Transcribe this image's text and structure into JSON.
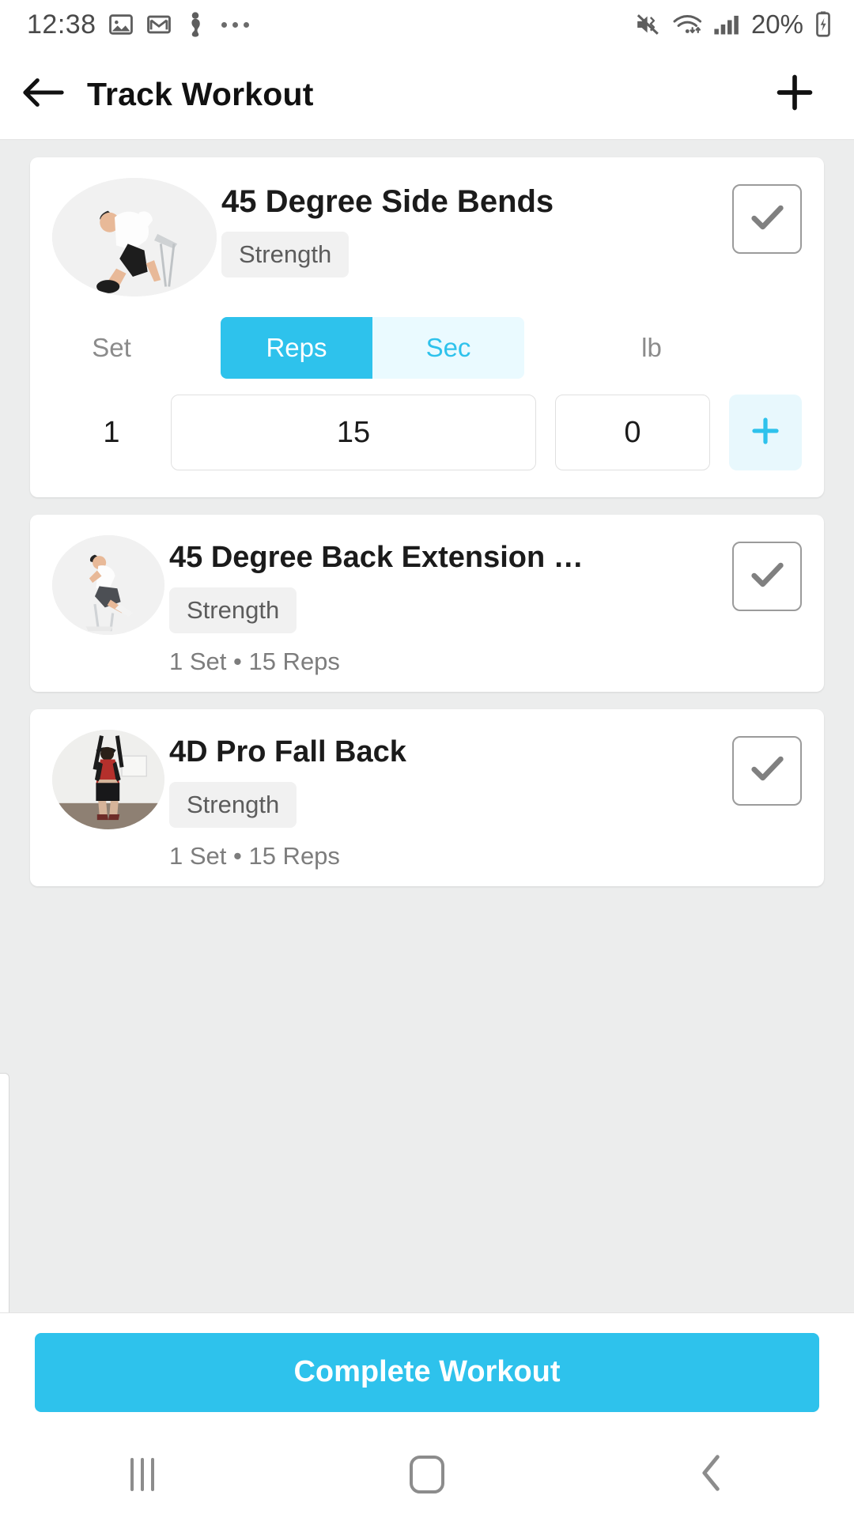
{
  "statusbar": {
    "time": "12:38",
    "battery": "20%",
    "icons": [
      "image-icon",
      "gmail-icon",
      "person-run-icon",
      "more-dots-icon",
      "mute-vibrate-icon",
      "wifi-icon",
      "cellular-signal-icon",
      "battery-charging-icon"
    ]
  },
  "appbar": {
    "title": "Track Workout",
    "back_icon": "arrow-left-icon",
    "add_icon": "plus-icon"
  },
  "exercises": [
    {
      "name": "45 Degree Side Bends",
      "tag": "Strength",
      "expanded": true,
      "set_header": {
        "set": "Set",
        "reps": "Reps",
        "sec": "Sec",
        "unit": "lb"
      },
      "active_mode": "Reps",
      "set_number": "1",
      "reps_value": "15",
      "weight_value": "0",
      "add_set_icon": "plus-icon",
      "check_icon": "check-icon"
    },
    {
      "name": "45 Degree Back Extension …",
      "tag": "Strength",
      "expanded": false,
      "summary": "1 Set • 15 Reps",
      "check_icon": "check-icon"
    },
    {
      "name": "4D Pro Fall Back",
      "tag": "Strength",
      "expanded": false,
      "summary": "1 Set • 15 Reps",
      "check_icon": "check-icon"
    }
  ],
  "bottom": {
    "cta_label": "Complete Workout"
  },
  "navbar": {
    "recents_icon": "recents-icon",
    "home_icon": "home-icon",
    "back_icon": "chevron-left-icon"
  },
  "colors": {
    "accent": "#2ec2ec",
    "accent_soft": "#eafaff",
    "add_bg": "#e8f8fd",
    "page_bg": "#eceded",
    "card": "#ffffff"
  }
}
